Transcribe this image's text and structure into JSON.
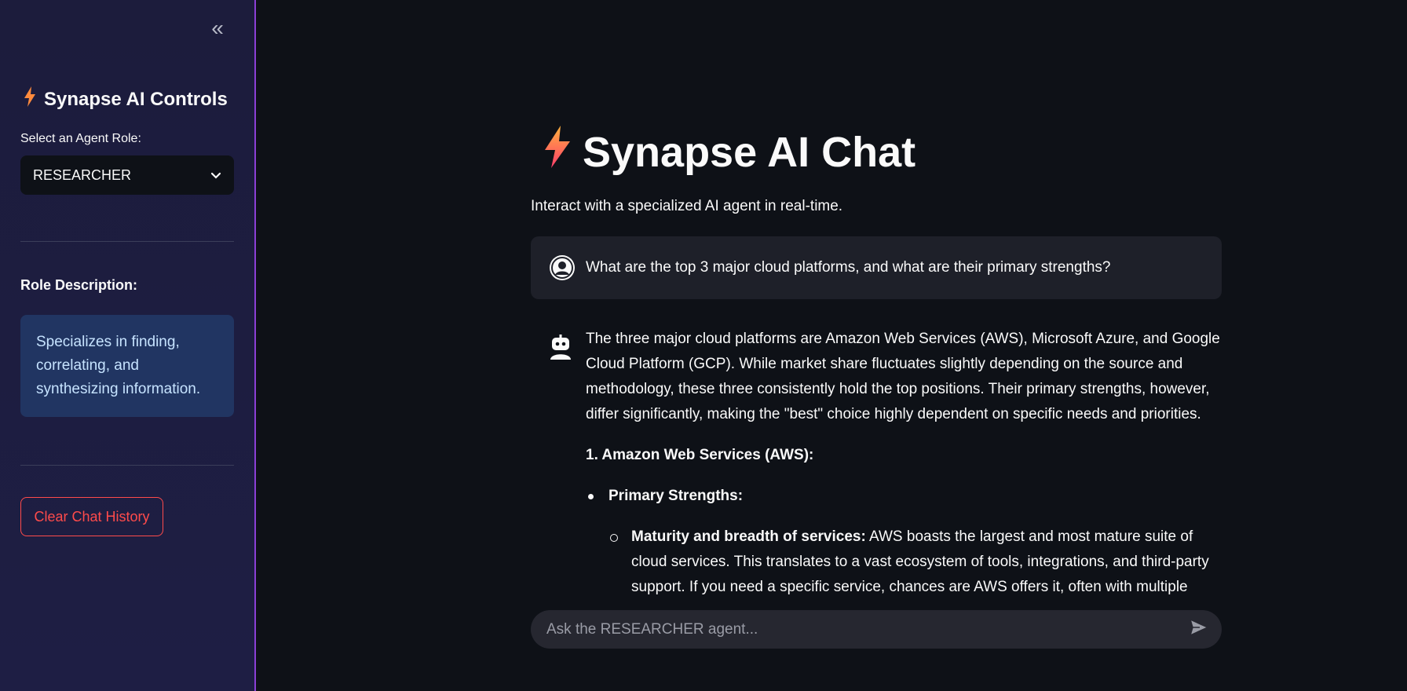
{
  "sidebar": {
    "collapse_icon": "double-chevron-left-icon",
    "title": "Synapse AI Controls",
    "title_icon": "lightning-icon",
    "select_label": "Select an Agent Role:",
    "selected_role": "RESEARCHER",
    "role_heading": "Role Description:",
    "role_description": "Specializes in finding, correlating, and synthesizing information.",
    "clear_button": "Clear Chat History"
  },
  "main": {
    "title": "Synapse AI Chat",
    "title_icon": "lightning-icon",
    "subtitle": "Interact with a specialized AI agent in real-time.",
    "messages": [
      {
        "role": "user",
        "icon": "user-avatar-icon",
        "text": "What are the top 3 major cloud platforms, and what are their primary strengths?"
      },
      {
        "role": "assistant",
        "icon": "robot-icon",
        "intro": "The three major cloud platforms are Amazon Web Services (AWS), Microsoft Azure, and Google Cloud Platform (GCP). While market share fluctuates slightly depending on the source and methodology, these three consistently hold the top positions. Their primary strengths, however, differ significantly, making the \"best\" choice highly dependent on specific needs and priorities.",
        "section_heading": "1. Amazon Web Services (AWS):",
        "bullet_heading": "Primary Strengths:",
        "sub_bullet_bold": "Maturity and breadth of services:",
        "sub_bullet_text": " AWS boasts the largest and most mature suite of cloud services. This translates to a vast ecosystem of tools, integrations, and third-party support. If you need a specific service, chances are AWS offers it, often with multiple options at"
      }
    ],
    "chat_input_placeholder": "Ask the RESEARCHER agent...",
    "send_icon": "send-icon"
  },
  "colors": {
    "sidebar_bg": "#1c1c3c",
    "main_bg": "#0e1117",
    "accent_border": "#8b3fd6",
    "danger": "#ff4b4b",
    "info_bg": "#213562",
    "info_text": "#c6e3ff"
  }
}
